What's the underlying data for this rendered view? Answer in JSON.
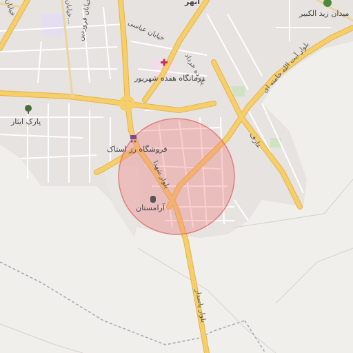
{
  "map": {
    "labels": {
      "city_top": "ابهر",
      "square_north": "میدان زید الکبیر",
      "clinic": "درمانگاه هفده شهریور",
      "park": "پارک ایثار",
      "store": "فروشگاه رز استاک",
      "cemetery": "آرامستان",
      "road_abbasi": "خیابان عباسی",
      "road_khordad": "پانزده خرداد",
      "road_khamenei": "بلوار آیت الله خامنه ای",
      "road_shohada": "بلوار شهدا",
      "road_pasdar": "بلوار پاسدار",
      "road_aref": "عارف",
      "road_farvardin": "خیابان فروردین",
      "road_khayam": "خیابان...",
      "road_left": "خیابان"
    },
    "icons": {
      "clinic": "cross-icon",
      "park": "tree-icon",
      "store": "shopping-cart-icon",
      "cemetery": "cemetery-icon",
      "square": "tree-icon"
    },
    "colors": {
      "major_road": "#f6cf6a",
      "road_casing": "#e2b34b",
      "land": "#f1efec",
      "block": "#e4e1de",
      "circle_fill": "#f08080",
      "circle_stroke": "#e05b5b"
    }
  }
}
